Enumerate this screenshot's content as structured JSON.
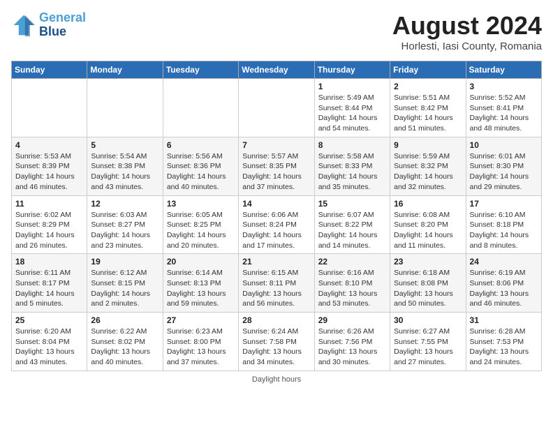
{
  "header": {
    "logo_line1": "General",
    "logo_line2": "Blue",
    "month": "August 2024",
    "location": "Horlesti, Iasi County, Romania"
  },
  "days_of_week": [
    "Sunday",
    "Monday",
    "Tuesday",
    "Wednesday",
    "Thursday",
    "Friday",
    "Saturday"
  ],
  "weeks": [
    [
      {
        "day": "",
        "info": ""
      },
      {
        "day": "",
        "info": ""
      },
      {
        "day": "",
        "info": ""
      },
      {
        "day": "",
        "info": ""
      },
      {
        "day": "1",
        "info": "Sunrise: 5:49 AM\nSunset: 8:44 PM\nDaylight: 14 hours and 54 minutes."
      },
      {
        "day": "2",
        "info": "Sunrise: 5:51 AM\nSunset: 8:42 PM\nDaylight: 14 hours and 51 minutes."
      },
      {
        "day": "3",
        "info": "Sunrise: 5:52 AM\nSunset: 8:41 PM\nDaylight: 14 hours and 48 minutes."
      }
    ],
    [
      {
        "day": "4",
        "info": "Sunrise: 5:53 AM\nSunset: 8:39 PM\nDaylight: 14 hours and 46 minutes."
      },
      {
        "day": "5",
        "info": "Sunrise: 5:54 AM\nSunset: 8:38 PM\nDaylight: 14 hours and 43 minutes."
      },
      {
        "day": "6",
        "info": "Sunrise: 5:56 AM\nSunset: 8:36 PM\nDaylight: 14 hours and 40 minutes."
      },
      {
        "day": "7",
        "info": "Sunrise: 5:57 AM\nSunset: 8:35 PM\nDaylight: 14 hours and 37 minutes."
      },
      {
        "day": "8",
        "info": "Sunrise: 5:58 AM\nSunset: 8:33 PM\nDaylight: 14 hours and 35 minutes."
      },
      {
        "day": "9",
        "info": "Sunrise: 5:59 AM\nSunset: 8:32 PM\nDaylight: 14 hours and 32 minutes."
      },
      {
        "day": "10",
        "info": "Sunrise: 6:01 AM\nSunset: 8:30 PM\nDaylight: 14 hours and 29 minutes."
      }
    ],
    [
      {
        "day": "11",
        "info": "Sunrise: 6:02 AM\nSunset: 8:29 PM\nDaylight: 14 hours and 26 minutes."
      },
      {
        "day": "12",
        "info": "Sunrise: 6:03 AM\nSunset: 8:27 PM\nDaylight: 14 hours and 23 minutes."
      },
      {
        "day": "13",
        "info": "Sunrise: 6:05 AM\nSunset: 8:25 PM\nDaylight: 14 hours and 20 minutes."
      },
      {
        "day": "14",
        "info": "Sunrise: 6:06 AM\nSunset: 8:24 PM\nDaylight: 14 hours and 17 minutes."
      },
      {
        "day": "15",
        "info": "Sunrise: 6:07 AM\nSunset: 8:22 PM\nDaylight: 14 hours and 14 minutes."
      },
      {
        "day": "16",
        "info": "Sunrise: 6:08 AM\nSunset: 8:20 PM\nDaylight: 14 hours and 11 minutes."
      },
      {
        "day": "17",
        "info": "Sunrise: 6:10 AM\nSunset: 8:18 PM\nDaylight: 14 hours and 8 minutes."
      }
    ],
    [
      {
        "day": "18",
        "info": "Sunrise: 6:11 AM\nSunset: 8:17 PM\nDaylight: 14 hours and 5 minutes."
      },
      {
        "day": "19",
        "info": "Sunrise: 6:12 AM\nSunset: 8:15 PM\nDaylight: 14 hours and 2 minutes."
      },
      {
        "day": "20",
        "info": "Sunrise: 6:14 AM\nSunset: 8:13 PM\nDaylight: 13 hours and 59 minutes."
      },
      {
        "day": "21",
        "info": "Sunrise: 6:15 AM\nSunset: 8:11 PM\nDaylight: 13 hours and 56 minutes."
      },
      {
        "day": "22",
        "info": "Sunrise: 6:16 AM\nSunset: 8:10 PM\nDaylight: 13 hours and 53 minutes."
      },
      {
        "day": "23",
        "info": "Sunrise: 6:18 AM\nSunset: 8:08 PM\nDaylight: 13 hours and 50 minutes."
      },
      {
        "day": "24",
        "info": "Sunrise: 6:19 AM\nSunset: 8:06 PM\nDaylight: 13 hours and 46 minutes."
      }
    ],
    [
      {
        "day": "25",
        "info": "Sunrise: 6:20 AM\nSunset: 8:04 PM\nDaylight: 13 hours and 43 minutes."
      },
      {
        "day": "26",
        "info": "Sunrise: 6:22 AM\nSunset: 8:02 PM\nDaylight: 13 hours and 40 minutes."
      },
      {
        "day": "27",
        "info": "Sunrise: 6:23 AM\nSunset: 8:00 PM\nDaylight: 13 hours and 37 minutes."
      },
      {
        "day": "28",
        "info": "Sunrise: 6:24 AM\nSunset: 7:58 PM\nDaylight: 13 hours and 34 minutes."
      },
      {
        "day": "29",
        "info": "Sunrise: 6:26 AM\nSunset: 7:56 PM\nDaylight: 13 hours and 30 minutes."
      },
      {
        "day": "30",
        "info": "Sunrise: 6:27 AM\nSunset: 7:55 PM\nDaylight: 13 hours and 27 minutes."
      },
      {
        "day": "31",
        "info": "Sunrise: 6:28 AM\nSunset: 7:53 PM\nDaylight: 13 hours and 24 minutes."
      }
    ]
  ],
  "footer": "Daylight hours"
}
